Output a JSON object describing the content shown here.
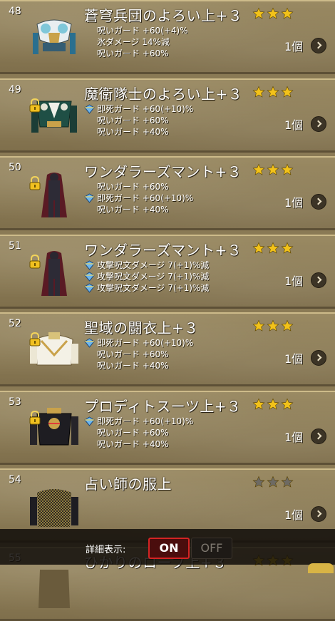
{
  "items": [
    {
      "number": "48",
      "name": "蒼穹兵団のよろい上+３",
      "rarity": 3,
      "locked": false,
      "icon": "armor-azure-icon",
      "stats": [
        {
          "text": "呪いガード +60(+4)%",
          "icon": null
        },
        {
          "text": "氷ダメージ 14%減",
          "icon": null
        },
        {
          "text": "呪いガード +60%",
          "icon": null
        }
      ],
      "quantity": "1個"
    },
    {
      "number": "49",
      "name": "魔衛隊士のよろい上+３",
      "rarity": 3,
      "locked": true,
      "icon": "armor-green-icon",
      "stats": [
        {
          "text": "即死ガード +60(+10)%",
          "icon": "crystal-icon"
        },
        {
          "text": "呪いガード +60%",
          "icon": null
        },
        {
          "text": "呪いガード +40%",
          "icon": null
        }
      ],
      "quantity": "1個"
    },
    {
      "number": "50",
      "name": "ワンダラーズマント+３",
      "rarity": 3,
      "locked": true,
      "icon": "cloak-icon",
      "stats": [
        {
          "text": "呪いガード +60%",
          "icon": null
        },
        {
          "text": "即死ガード +60(+10)%",
          "icon": "crystal-icon"
        },
        {
          "text": "呪いガード +40%",
          "icon": null
        }
      ],
      "quantity": "1個"
    },
    {
      "number": "51",
      "name": "ワンダラーズマント+３",
      "rarity": 3,
      "locked": true,
      "icon": "cloak-icon",
      "stats": [
        {
          "text": "攻撃呪文ダメージ 7(+1)%減",
          "icon": "crystal-icon"
        },
        {
          "text": "攻撃呪文ダメージ 7(+1)%減",
          "icon": "crystal-icon"
        },
        {
          "text": "攻撃呪文ダメージ 7(+1)%減",
          "icon": "crystal-icon"
        }
      ],
      "quantity": "1個"
    },
    {
      "number": "52",
      "name": "聖域の闘衣上+３",
      "rarity": 3,
      "locked": true,
      "icon": "robe-white-icon",
      "stats": [
        {
          "text": "即死ガード +60(+10)%",
          "icon": "crystal-icon"
        },
        {
          "text": "呪いガード +60%",
          "icon": null
        },
        {
          "text": "呪いガード +40%",
          "icon": null
        }
      ],
      "quantity": "1個"
    },
    {
      "number": "53",
      "name": "プロディトスーツ上+３",
      "rarity": 3,
      "locked": true,
      "icon": "suit-black-icon",
      "stats": [
        {
          "text": "即死ガード +60(+10)%",
          "icon": "crystal-icon"
        },
        {
          "text": "呪いガード +60%",
          "icon": null
        },
        {
          "text": "呪いガード +40%",
          "icon": null
        }
      ],
      "quantity": "1個"
    },
    {
      "number": "54",
      "name": "占い師の服上",
      "rarity": 0,
      "locked": false,
      "icon": "mesh-top-icon",
      "stats": [],
      "quantity": "1個"
    },
    {
      "number": "55",
      "name": "ひかりのローブ上+３",
      "rarity": 3,
      "locked": false,
      "icon": "robe-icon",
      "stats": [],
      "quantity": ""
    }
  ],
  "detail_toggle": {
    "label": "詳細表示:",
    "on_label": "ON",
    "off_label": "OFF",
    "active": "ON"
  },
  "colors": {
    "star_active": "#f2c21a",
    "star_inactive": "#6d6a63",
    "toggle_on_border": "#d42323"
  }
}
